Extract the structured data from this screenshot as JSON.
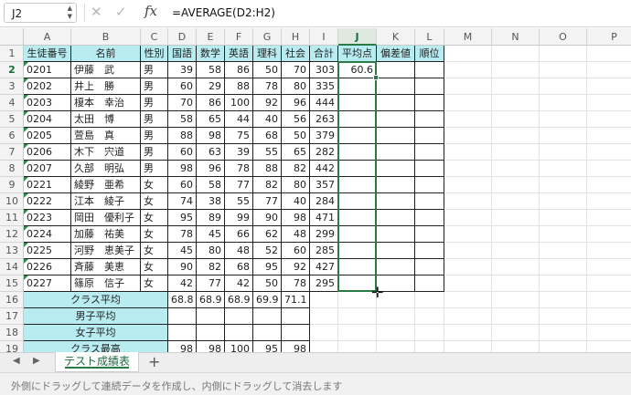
{
  "formula_bar": {
    "name_box": "J2",
    "cancel_glyph": "✕",
    "confirm_glyph": "✓",
    "fx_label": "fx",
    "formula": "=AVERAGE(D2:H2)"
  },
  "columns": [
    "A",
    "B",
    "C",
    "D",
    "E",
    "F",
    "G",
    "H",
    "I",
    "J",
    "K",
    "L",
    "M",
    "N",
    "O",
    "P"
  ],
  "selected_column": "J",
  "rows": [
    "1",
    "2",
    "3",
    "4",
    "5",
    "6",
    "7",
    "8",
    "9",
    "10",
    "11",
    "12",
    "13",
    "14",
    "15",
    "16",
    "17",
    "18",
    "19"
  ],
  "selected_row": "2",
  "table": {
    "headers": [
      "生徒番号",
      "名前",
      "性別",
      "国語",
      "数学",
      "英語",
      "理科",
      "社会",
      "合計",
      "平均点",
      "偏差値",
      "順位"
    ],
    "students": [
      {
        "id": "0201",
        "name": "伊藤　武",
        "sex": "男",
        "scores": [
          "39",
          "58",
          "86",
          "50",
          "70"
        ],
        "total": "303",
        "avg": "60.6"
      },
      {
        "id": "0202",
        "name": "井上　勝",
        "sex": "男",
        "scores": [
          "60",
          "29",
          "88",
          "78",
          "80"
        ],
        "total": "335",
        "avg": ""
      },
      {
        "id": "0203",
        "name": "榎本　幸治",
        "sex": "男",
        "scores": [
          "70",
          "86",
          "100",
          "92",
          "96"
        ],
        "total": "444",
        "avg": ""
      },
      {
        "id": "0204",
        "name": "太田　博",
        "sex": "男",
        "scores": [
          "58",
          "65",
          "44",
          "40",
          "56"
        ],
        "total": "263",
        "avg": ""
      },
      {
        "id": "0205",
        "name": "萱島　真",
        "sex": "男",
        "scores": [
          "88",
          "98",
          "75",
          "68",
          "50"
        ],
        "total": "379",
        "avg": ""
      },
      {
        "id": "0206",
        "name": "木下　宍道",
        "sex": "男",
        "scores": [
          "60",
          "63",
          "39",
          "55",
          "65"
        ],
        "total": "282",
        "avg": ""
      },
      {
        "id": "0207",
        "name": "久部　明弘",
        "sex": "男",
        "scores": [
          "98",
          "96",
          "78",
          "88",
          "82"
        ],
        "total": "442",
        "avg": ""
      },
      {
        "id": "0221",
        "name": "綾野　亜希",
        "sex": "女",
        "scores": [
          "60",
          "58",
          "77",
          "82",
          "80"
        ],
        "total": "357",
        "avg": ""
      },
      {
        "id": "0222",
        "name": "江本　綾子",
        "sex": "女",
        "scores": [
          "74",
          "38",
          "55",
          "77",
          "40"
        ],
        "total": "284",
        "avg": ""
      },
      {
        "id": "0223",
        "name": "岡田　優利子",
        "sex": "女",
        "scores": [
          "95",
          "89",
          "99",
          "90",
          "98"
        ],
        "total": "471",
        "avg": ""
      },
      {
        "id": "0224",
        "name": "加藤　祐美",
        "sex": "女",
        "scores": [
          "78",
          "45",
          "66",
          "62",
          "48"
        ],
        "total": "299",
        "avg": ""
      },
      {
        "id": "0225",
        "name": "河野　恵美子",
        "sex": "女",
        "scores": [
          "45",
          "80",
          "48",
          "52",
          "60"
        ],
        "total": "285",
        "avg": ""
      },
      {
        "id": "0226",
        "name": "斉藤　美恵",
        "sex": "女",
        "scores": [
          "90",
          "82",
          "68",
          "95",
          "92"
        ],
        "total": "427",
        "avg": ""
      },
      {
        "id": "0227",
        "name": "篠原　信子",
        "sex": "女",
        "scores": [
          "42",
          "77",
          "42",
          "50",
          "78"
        ],
        "total": "295",
        "avg": ""
      }
    ],
    "summary": [
      {
        "label": "クラス平均",
        "values": [
          "68.8",
          "68.9",
          "68.9",
          "69.9",
          "71.1"
        ]
      },
      {
        "label": "男子平均",
        "values": [
          "",
          "",
          "",
          "",
          ""
        ]
      },
      {
        "label": "女子平均",
        "values": [
          "",
          "",
          "",
          "",
          ""
        ]
      },
      {
        "label": "クラス最高",
        "values": [
          "98",
          "98",
          "100",
          "95",
          "98"
        ]
      }
    ]
  },
  "sheet_tabs": {
    "prev_glyph": "◀",
    "next_glyph": "▶",
    "active": "テスト成績表",
    "add_glyph": "+"
  },
  "status_bar": {
    "message": "外側にドラッグして連続データを作成し、内側にドラッグして消去します"
  },
  "colors": {
    "header_fill": "#b8ecf1",
    "selection_green": "#2a7a45",
    "error_marker": "#2f8a4b"
  },
  "icons": [
    "chevron-updown-icon",
    "cancel-icon",
    "confirm-icon",
    "fx-icon",
    "crosshair-cursor-icon",
    "prev-sheet-icon",
    "next-sheet-icon",
    "add-sheet-icon"
  ]
}
